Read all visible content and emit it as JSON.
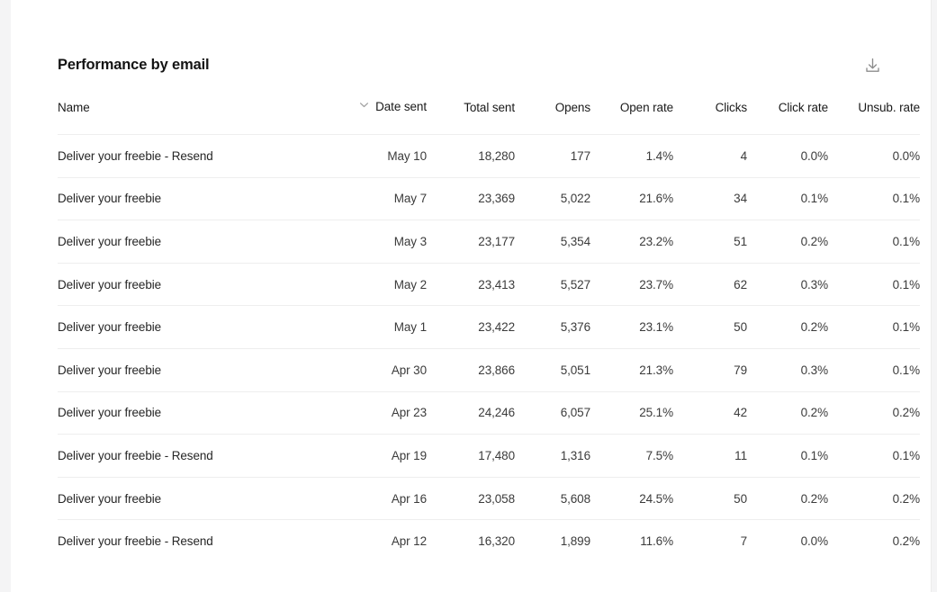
{
  "panel": {
    "title": "Performance by email",
    "download_icon": "download-icon",
    "sort_icon": "chevron-down-icon"
  },
  "table": {
    "columns": [
      {
        "key": "name",
        "label": "Name"
      },
      {
        "key": "date_sent",
        "label": "Date sent"
      },
      {
        "key": "total_sent",
        "label": "Total sent"
      },
      {
        "key": "opens",
        "label": "Opens"
      },
      {
        "key": "open_rate",
        "label": "Open rate"
      },
      {
        "key": "clicks",
        "label": "Clicks"
      },
      {
        "key": "click_rate",
        "label": "Click rate"
      },
      {
        "key": "unsub_rate",
        "label": "Unsub. rate"
      }
    ],
    "sorted_column": "Date sent",
    "rows": [
      {
        "name": "Deliver your freebie - Resend",
        "date_sent": "May 10",
        "total_sent": "18,280",
        "opens": "177",
        "open_rate": "1.4%",
        "clicks": "4",
        "click_rate": "0.0%",
        "unsub_rate": "0.0%"
      },
      {
        "name": "Deliver your freebie",
        "date_sent": "May 7",
        "total_sent": "23,369",
        "opens": "5,022",
        "open_rate": "21.6%",
        "clicks": "34",
        "click_rate": "0.1%",
        "unsub_rate": "0.1%"
      },
      {
        "name": "Deliver your freebie",
        "date_sent": "May 3",
        "total_sent": "23,177",
        "opens": "5,354",
        "open_rate": "23.2%",
        "clicks": "51",
        "click_rate": "0.2%",
        "unsub_rate": "0.1%"
      },
      {
        "name": "Deliver your freebie",
        "date_sent": "May 2",
        "total_sent": "23,413",
        "opens": "5,527",
        "open_rate": "23.7%",
        "clicks": "62",
        "click_rate": "0.3%",
        "unsub_rate": "0.1%"
      },
      {
        "name": "Deliver your freebie",
        "date_sent": "May 1",
        "total_sent": "23,422",
        "opens": "5,376",
        "open_rate": "23.1%",
        "clicks": "50",
        "click_rate": "0.2%",
        "unsub_rate": "0.1%"
      },
      {
        "name": "Deliver your freebie",
        "date_sent": "Apr 30",
        "total_sent": "23,866",
        "opens": "5,051",
        "open_rate": "21.3%",
        "clicks": "79",
        "click_rate": "0.3%",
        "unsub_rate": "0.1%"
      },
      {
        "name": "Deliver your freebie",
        "date_sent": "Apr 23",
        "total_sent": "24,246",
        "opens": "6,057",
        "open_rate": "25.1%",
        "clicks": "42",
        "click_rate": "0.2%",
        "unsub_rate": "0.2%"
      },
      {
        "name": "Deliver your freebie - Resend",
        "date_sent": "Apr 19",
        "total_sent": "17,480",
        "opens": "1,316",
        "open_rate": "7.5%",
        "clicks": "11",
        "click_rate": "0.1%",
        "unsub_rate": "0.1%"
      },
      {
        "name": "Deliver your freebie",
        "date_sent": "Apr 16",
        "total_sent": "23,058",
        "opens": "5,608",
        "open_rate": "24.5%",
        "clicks": "50",
        "click_rate": "0.2%",
        "unsub_rate": "0.2%"
      },
      {
        "name": "Deliver your freebie - Resend",
        "date_sent": "Apr 12",
        "total_sent": "16,320",
        "opens": "1,899",
        "open_rate": "11.6%",
        "clicks": "7",
        "click_rate": "0.0%",
        "unsub_rate": "0.2%"
      }
    ]
  },
  "colors": {
    "page_background": "#f4f4f5",
    "card_background": "#ffffff",
    "title_text": "#141414",
    "body_text": "#3b3b3b",
    "divider": "#eeeeee",
    "icon": "#8c8c8c"
  }
}
